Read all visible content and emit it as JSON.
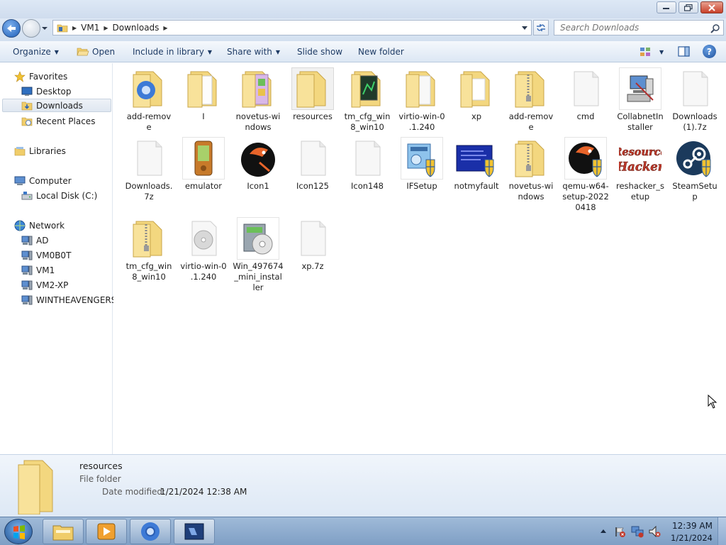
{
  "address": {
    "path": [
      "VM1",
      "Downloads"
    ]
  },
  "search": {
    "placeholder": "Search Downloads"
  },
  "toolbar": {
    "organize": "Organize",
    "open": "Open",
    "include": "Include in library",
    "share": "Share with",
    "slideshow": "Slide show",
    "newfolder": "New folder"
  },
  "nav": {
    "favorites": "Favorites",
    "desktop": "Desktop",
    "downloads": "Downloads",
    "recent": "Recent Places",
    "libraries": "Libraries",
    "computer": "Computer",
    "localdisk": "Local Disk (C:)",
    "network": "Network",
    "hosts": [
      "AD",
      "VM0B0T",
      "VM1",
      "VM2-XP",
      "WINTHEAVENGERS"
    ]
  },
  "files": [
    "add-remove",
    "I",
    "novetus-windows",
    "resources",
    "tm_cfg_win8_win10",
    "virtio-win-0.1.240",
    "xp",
    "add-remove",
    "cmd",
    "CollabnetInstaller",
    "Downloads (1).7z",
    "Downloads.7z",
    "emulator",
    "Icon1",
    "Icon125",
    "Icon148",
    "IFSetup",
    "notmyfault",
    "novetus-windows",
    "qemu-w64-setup-20220418",
    "reshacker_setup",
    "SteamSetup",
    "tm_cfg_win8_win10",
    "virtio-win-0.1.240",
    "Win_497674_mini_installer",
    "xp.7z"
  ],
  "file_labels": [
    "add-remov\ne",
    "I",
    "novetus-wi\nndows",
    "resources",
    "tm_cfg_win\n8_win10",
    "virtio-win-0\n.1.240",
    "xp",
    "add-remov\ne",
    "cmd",
    "CollabnetIn\nstaller",
    "Downloads\n(1).7z",
    "Downloads.\n7z",
    "emulator",
    "Icon1",
    "Icon125",
    "Icon148",
    "IFSetup",
    "notmyfault",
    "novetus-wi\nndows",
    "qemu-w64-\nsetup-2022\n0418",
    "reshacker_s\netup",
    "SteamSetu\np",
    "tm_cfg_win\n8_win10",
    "virtio-win-0\n.1.240",
    "Win_497674\n_mini_instal\nler",
    "xp.7z"
  ],
  "details": {
    "name": "resources",
    "type": "File folder",
    "modified_label": "Date modified:",
    "modified_value": "1/21/2024 12:38 AM"
  },
  "clock": {
    "time": "12:39 AM",
    "date": "1/21/2024"
  },
  "colors": {
    "folder": "#f3d77f",
    "accent": "#1e5fb8"
  }
}
